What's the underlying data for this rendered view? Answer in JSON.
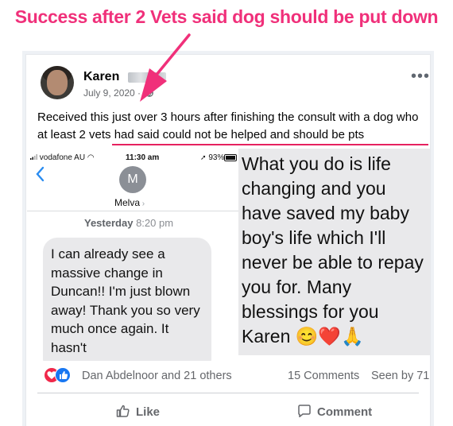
{
  "headline": "Success after 2 Vets said dog should be put down",
  "post": {
    "author": "Karen",
    "date": "July 9, 2020 ·",
    "text": "Received this just over 3 hours after finishing the consult with a dog who at least 2 vets had said could not be helped and should be pts"
  },
  "phone": {
    "carrier": "vodafone AU",
    "time": "11:30 am",
    "battery": "93%",
    "contact_initial": "M",
    "contact_name": "Melva",
    "timestamp_day": "Yesterday",
    "timestamp_time": "8:20 pm",
    "message": "I can already see a massive change in Duncan!! I'm just blown away! Thank you so very much once again. It hasn't"
  },
  "extended_message": "What you do is life changing and you have saved my baby boy's life which I'll never be able to repay you for. Many blessings for you Karen 😊❤️🙏",
  "stats": {
    "reactions": "Dan Abdelnoor and 21 others",
    "comments": "15 Comments",
    "seen": "Seen by 71"
  },
  "actions": {
    "like": "Like",
    "comment": "Comment"
  },
  "colors": {
    "accent_pink": "#f0307a",
    "facebook_blue": "#1877f2",
    "heart_red": "#f0284a"
  }
}
